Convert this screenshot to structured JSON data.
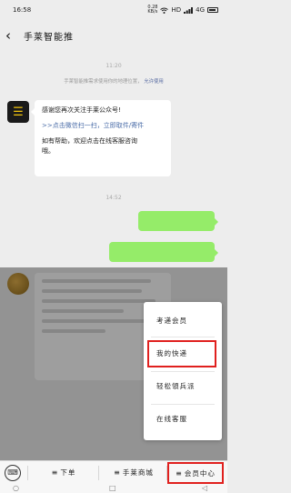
{
  "status": {
    "time": "16:58",
    "speed_value": "0.28",
    "speed_unit": "KB/s",
    "network": "HD",
    "signal": "4G"
  },
  "header": {
    "back_icon": "chevron-left-icon",
    "title": "手莱智能推"
  },
  "chat": {
    "timestamp_1": "11:20",
    "system_note_text": "手莱智能推需求使用你的地理位置，",
    "system_note_link": "允许使用",
    "welcome": {
      "line_1": "感谢您再次关注手莱公众号!",
      "link_1": ">>点击微信扫一扫，立即取件/寄件",
      "line_2": "如有帮助，欢迎点击在线客服咨询",
      "line_3": "哦。"
    },
    "timestamp_2": "14:52"
  },
  "popup_menu": {
    "items": [
      "考递会员",
      "我的快递",
      "轻松領兵派",
      "在线客服"
    ],
    "active_index": 1
  },
  "menu_bar": {
    "keyboard_icon": "keyboard-icon",
    "items": [
      {
        "label": "下单",
        "prefix": "≡"
      },
      {
        "label": "手莱商城",
        "prefix": "≡"
      },
      {
        "label": "会员中心",
        "prefix": "≡"
      }
    ],
    "active_index": 2
  },
  "nav_bar": {
    "home_icon": "circle-icon",
    "recent_icon": "square-icon",
    "back_icon": "triangle-back-icon"
  },
  "colors": {
    "highlight": "#e0201e",
    "outgoing_bubble": "#95ec69",
    "link": "#4b6da8"
  }
}
